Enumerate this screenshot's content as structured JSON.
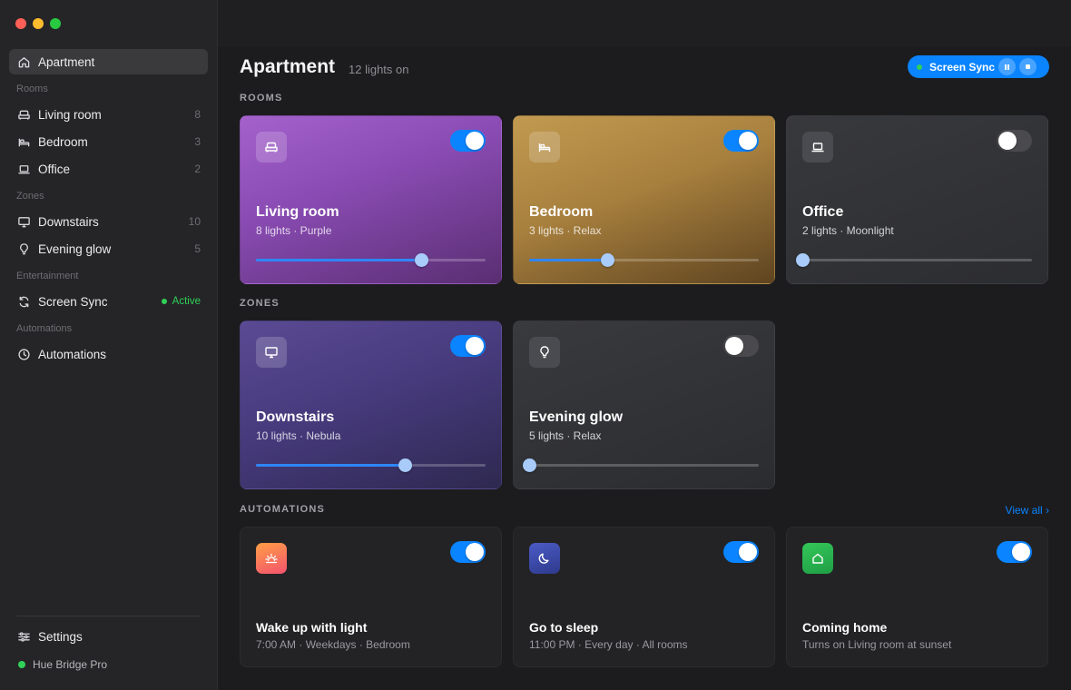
{
  "sidebar": {
    "top_item": {
      "label": "Apartment",
      "icon": "home-icon"
    },
    "sections": {
      "rooms": "Rooms",
      "zones": "Zones",
      "entertainment": "Entertainment",
      "automations": "Automations"
    },
    "rooms": [
      {
        "label": "Living room",
        "count": "8",
        "icon": "sofa-icon"
      },
      {
        "label": "Bedroom",
        "count": "3",
        "icon": "bed-icon"
      },
      {
        "label": "Office",
        "count": "2",
        "icon": "laptop-icon"
      }
    ],
    "zones": [
      {
        "label": "Downstairs",
        "count": "10",
        "icon": "monitor-icon"
      },
      {
        "label": "Evening glow",
        "count": "5",
        "icon": "bulb-icon"
      }
    ],
    "entertainment": {
      "label": "Screen Sync",
      "status": "Active",
      "icon": "sync-icon"
    },
    "automations_item": {
      "label": "Automations",
      "icon": "clock-icon"
    },
    "settings": {
      "label": "Settings",
      "icon": "sliders-icon"
    },
    "bridge": {
      "label": "Hue Bridge Pro"
    }
  },
  "header": {
    "title": "Apartment",
    "subtitle": "12 lights on",
    "screen_sync": {
      "label": "Screen Sync"
    }
  },
  "sections": {
    "rooms": "ROOMS",
    "zones": "ZONES",
    "automations": "AUTOMATIONS",
    "view_all": "View all ›"
  },
  "rooms": [
    {
      "name": "Living room",
      "meta": "8 lights · Purple",
      "on": true,
      "brightness": 0.72,
      "icon": "sofa-icon"
    },
    {
      "name": "Bedroom",
      "meta": "3 lights · Relax",
      "on": true,
      "brightness": 0.34,
      "icon": "bed-icon"
    },
    {
      "name": "Office",
      "meta": "2 lights · Moonlight",
      "on": false,
      "brightness": 0.0,
      "icon": "laptop-icon"
    }
  ],
  "zones": [
    {
      "name": "Downstairs",
      "meta": "10 lights · Nebula",
      "on": true,
      "brightness": 0.65,
      "icon": "monitor-icon"
    },
    {
      "name": "Evening glow",
      "meta": "5 lights · Relax",
      "on": false,
      "brightness": 0.0,
      "icon": "bulb-icon"
    }
  ],
  "automations": [
    {
      "name": "Wake up with light",
      "meta": "7:00 AM · Weekdays · Bedroom",
      "on": true,
      "icon": "sunrise-icon"
    },
    {
      "name": "Go to sleep",
      "meta": "11:00 PM · Every day · All rooms",
      "on": true,
      "icon": "moon-icon"
    },
    {
      "name": "Coming home",
      "meta": "Turns on Living room at sunset",
      "on": true,
      "icon": "home-icon"
    }
  ],
  "colors": {
    "accent": "#0a84ff",
    "active_green": "#30d158",
    "living_room": "#a461cc",
    "bedroom": "#c19a50",
    "downstairs": "#5a4a94"
  }
}
